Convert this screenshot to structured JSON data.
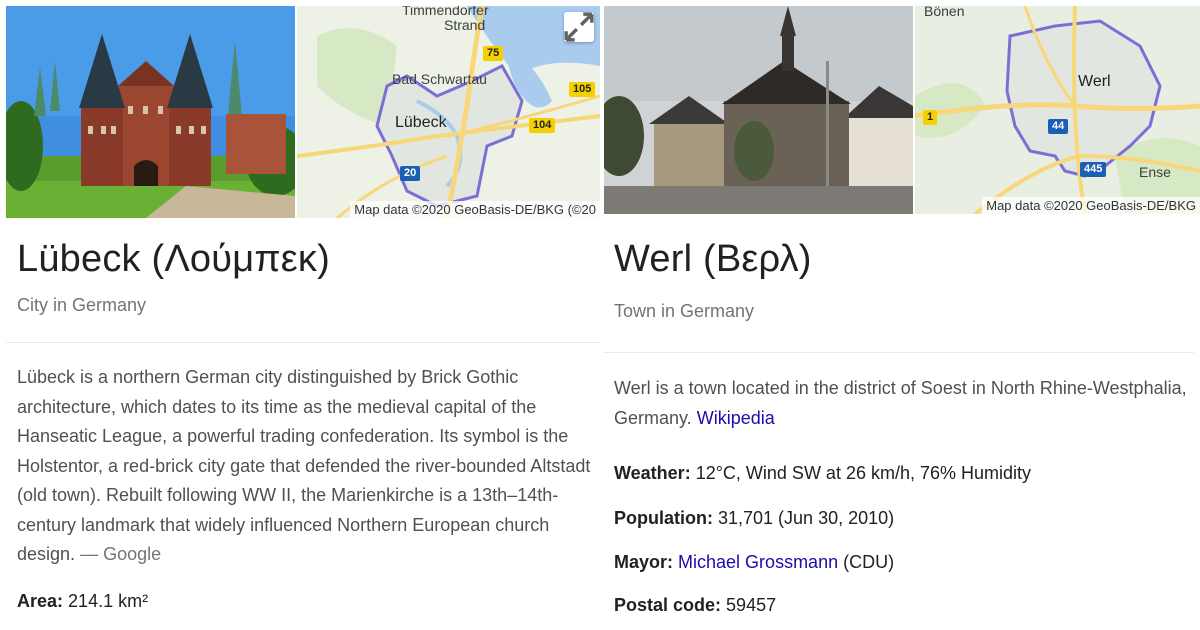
{
  "left": {
    "title": "Lübeck (Λούμπεκ)",
    "subtitle": "City in Germany",
    "description": "Lübeck is a northern German city distinguished by Brick Gothic architecture, which dates to its time as the medieval capital of the Hanseatic League, a powerful trading confederation. Its symbol is the Holstentor, a red-brick city gate that defended the river-bounded Altstadt (old town). Rebuilt following WW II, the Marienkirche is a 13th–14th-century landmark that widely influenced Northern European church design.",
    "source": "— Google",
    "facts": [
      {
        "label": "Area:",
        "value": "214.1 km²"
      }
    ],
    "map": {
      "attribution": "Map data ©2020 GeoBasis-DE/BKG (©20",
      "labels": {
        "top": "Timmendorfer",
        "top2": "Strand",
        "town1": "Bad Schwartau",
        "city": "Lübeck"
      },
      "shields": {
        "a": "75",
        "b": "105",
        "c": "104",
        "d": "20"
      }
    }
  },
  "right": {
    "title": "Werl (Βερλ)",
    "subtitle": "Town in Germany",
    "description": "Werl is a town located in the district of Soest in North Rhine-Westphalia, Germany.",
    "source_link": "Wikipedia",
    "facts": [
      {
        "label": "Weather:",
        "value": "12°C, Wind SW at 26 km/h, 76% Humidity"
      },
      {
        "label": "Population:",
        "value": "31,701 (Jun 30, 2010)"
      },
      {
        "label": "Mayor:",
        "link": "Michael Grossmann",
        "value": "(CDU)"
      },
      {
        "label": "Postal code:",
        "value": "59457"
      }
    ],
    "map": {
      "attribution": "Map data ©2020 GeoBasis-DE/BKG",
      "labels": {
        "top": "Bönen",
        "city": "Werl",
        "town2": "Ense"
      },
      "shields": {
        "a": "1",
        "b": "44",
        "c": "445"
      }
    }
  },
  "colors": {
    "link": "#1a0dab",
    "title": "#202124",
    "muted": "#70757a",
    "map_boundary": "#7b6fd6"
  }
}
